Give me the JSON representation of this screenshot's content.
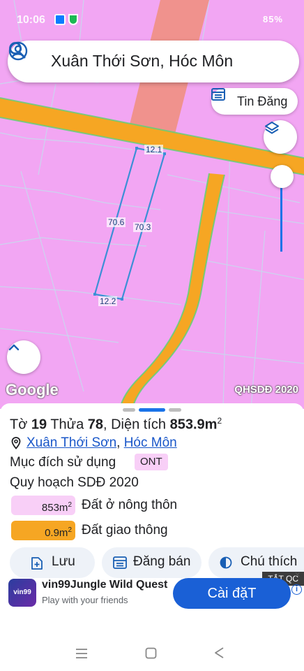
{
  "status": {
    "time": "10:06",
    "right": "85%"
  },
  "search": {
    "query": "Xuân Thới Sơn, Hóc Môn"
  },
  "map_controls": {
    "tin_dang_label": "Tin Đăng",
    "attribution": "Google",
    "layer_label": "QHSDĐ 2020"
  },
  "parcel_dims": {
    "top": "12.1",
    "left": "70.6",
    "right": "70.3",
    "bottom": "12.2"
  },
  "sheet": {
    "title": {
      "prefix": "Tờ ",
      "sheet_no": "19",
      "mid": " Thửa ",
      "parcel_no": "78",
      "area_label": ", Diện tích ",
      "area": "853.9m",
      "unit_sup": "2"
    },
    "location": {
      "ward": "Xuân Thới Sơn",
      "sep": ", ",
      "district": "Hóc Môn"
    },
    "purpose_label": "Mục đích sử dụng",
    "purpose_code": "ONT",
    "plan_label": "Quy hoạch SDĐ 2020",
    "legend": [
      {
        "value": "853m",
        "sup": "2",
        "text": "Đất ở nông thôn",
        "color": "#f8cff7"
      },
      {
        "value": "0.9m",
        "sup": "2",
        "text": "Đất giao thông",
        "color": "#f6a623"
      }
    ],
    "actions": [
      {
        "label": "Lưu",
        "icon": "save-icon"
      },
      {
        "label": "Đăng bán",
        "icon": "listing-icon"
      },
      {
        "label": "Chú thích",
        "icon": "legend-icon"
      }
    ]
  },
  "ad": {
    "close_label": "TẮT QC",
    "title": "vin99Jungle Wild Quest",
    "subtitle": "Play with your friends",
    "cta": "Cài đặT",
    "logo_text": "vin99"
  },
  "colors": {
    "map_pink": "#f2a6f3",
    "road_orange": "#f6a623",
    "accent_blue": "#1a73e8"
  }
}
